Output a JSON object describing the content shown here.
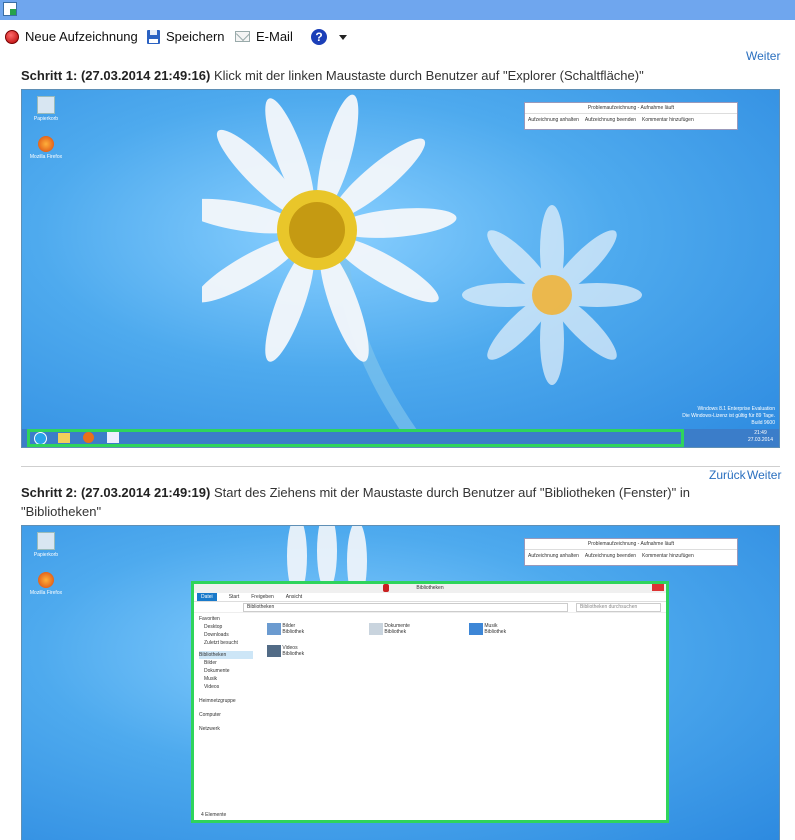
{
  "toolbar": {
    "new_recording": "Neue Aufzeichnung",
    "save": "Speichern",
    "email": "E-Mail",
    "help_glyph": "?"
  },
  "nav": {
    "next_top": "Weiter",
    "back": "Zurück",
    "next": "Weiter"
  },
  "steps": [
    {
      "label": "Schritt 1: (27.03.2014 21:49:16)",
      "description": "Klick mit der linken Maustaste durch Benutzer auf \"Explorer (Schaltfläche)\""
    },
    {
      "label": "Schritt 2: (27.03.2014 21:49:19)",
      "description": "Start des Ziehens mit der Maustaste durch Benutzer auf \"Bibliotheken (Fenster)\" in \"Bibliotheken\""
    }
  ],
  "screenshot": {
    "desktop_icons": [
      "Papierkorb",
      "Mozilla Firefox"
    ],
    "psr_title": "Problemaufzeichnung - Aufnahme läuft",
    "psr_buttons": [
      "Aufzeichnung anhalten",
      "Aufzeichnung beenden",
      "Kommentar hinzufügen"
    ],
    "watermark": [
      "Windows 8.1 Enterprise Evaluation",
      "Die Windows-Lizenz ist gültig für 89 Tage.",
      "Build 9600"
    ],
    "clock_time": "21:49",
    "clock_date": "27.03.2014",
    "explorer_title": "Bibliotheken",
    "explorer_tabs": [
      "Datei",
      "Start",
      "Freigeben",
      "Ansicht"
    ],
    "explorer_path": "Bibliotheken",
    "explorer_search": "Bibliotheken durchsuchen",
    "nav_pane": [
      "Favoriten",
      "Desktop",
      "Downloads",
      "Zuletzt besucht",
      "Bibliotheken",
      "Bilder",
      "Dokumente",
      "Musik",
      "Videos",
      "Heimnetzgruppe",
      "Computer",
      "Netzwerk"
    ],
    "libraries": [
      {
        "name": "Bilder",
        "type": "Bibliothek"
      },
      {
        "name": "Dokumente",
        "type": "Bibliothek"
      },
      {
        "name": "Musik",
        "type": "Bibliothek"
      },
      {
        "name": "Videos",
        "type": "Bibliothek"
      }
    ],
    "status": "4 Elemente"
  },
  "colors": {
    "highlight": "#2fd45c",
    "link": "#2a6fbf",
    "titlebar": "#6fa6ee"
  }
}
